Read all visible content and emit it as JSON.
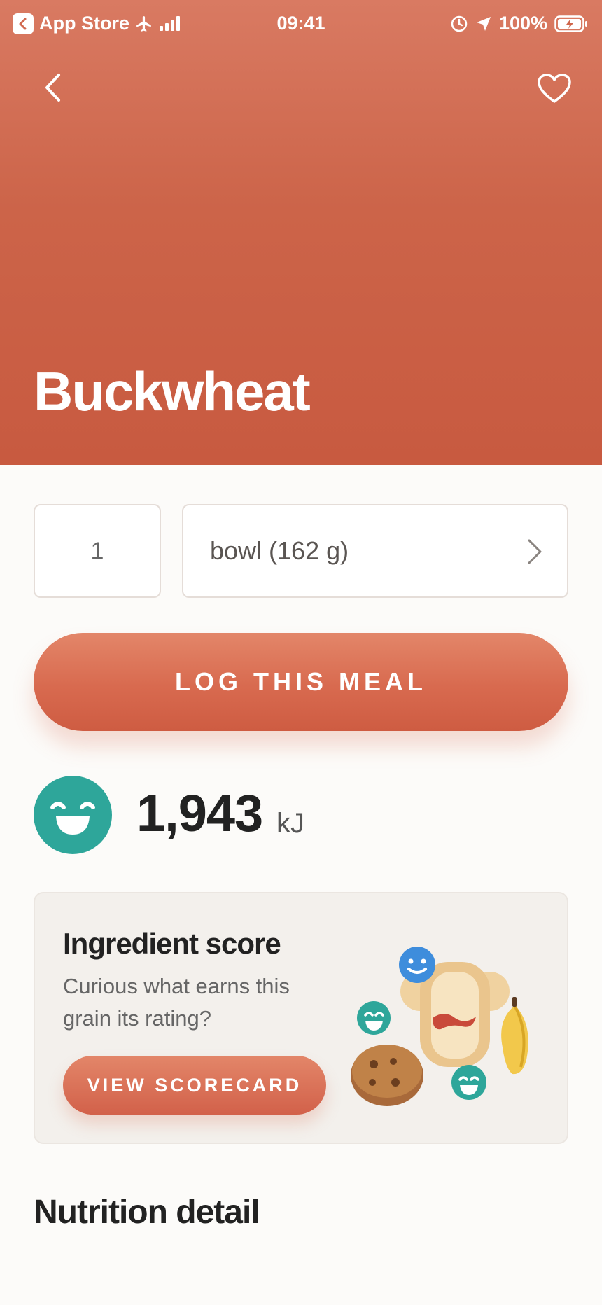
{
  "status_bar": {
    "back_app": "App Store",
    "time": "09:41",
    "battery": "100%"
  },
  "food": {
    "name": "Buckwheat"
  },
  "serving": {
    "quantity": "1",
    "unit": "bowl (162 g)"
  },
  "actions": {
    "log_label": "LOG THIS MEAL"
  },
  "energy": {
    "value": "1,943",
    "unit": "kJ"
  },
  "ingredient_card": {
    "title": "Ingredient score",
    "description": "Curious what earns this grain its rating?",
    "button_label": "VIEW SCORECARD"
  },
  "sections": {
    "nutrition_title": "Nutrition detail"
  },
  "colors": {
    "accent": "#d86a4f",
    "score_teal": "#2ea69a",
    "background": "#fcfbf9"
  }
}
